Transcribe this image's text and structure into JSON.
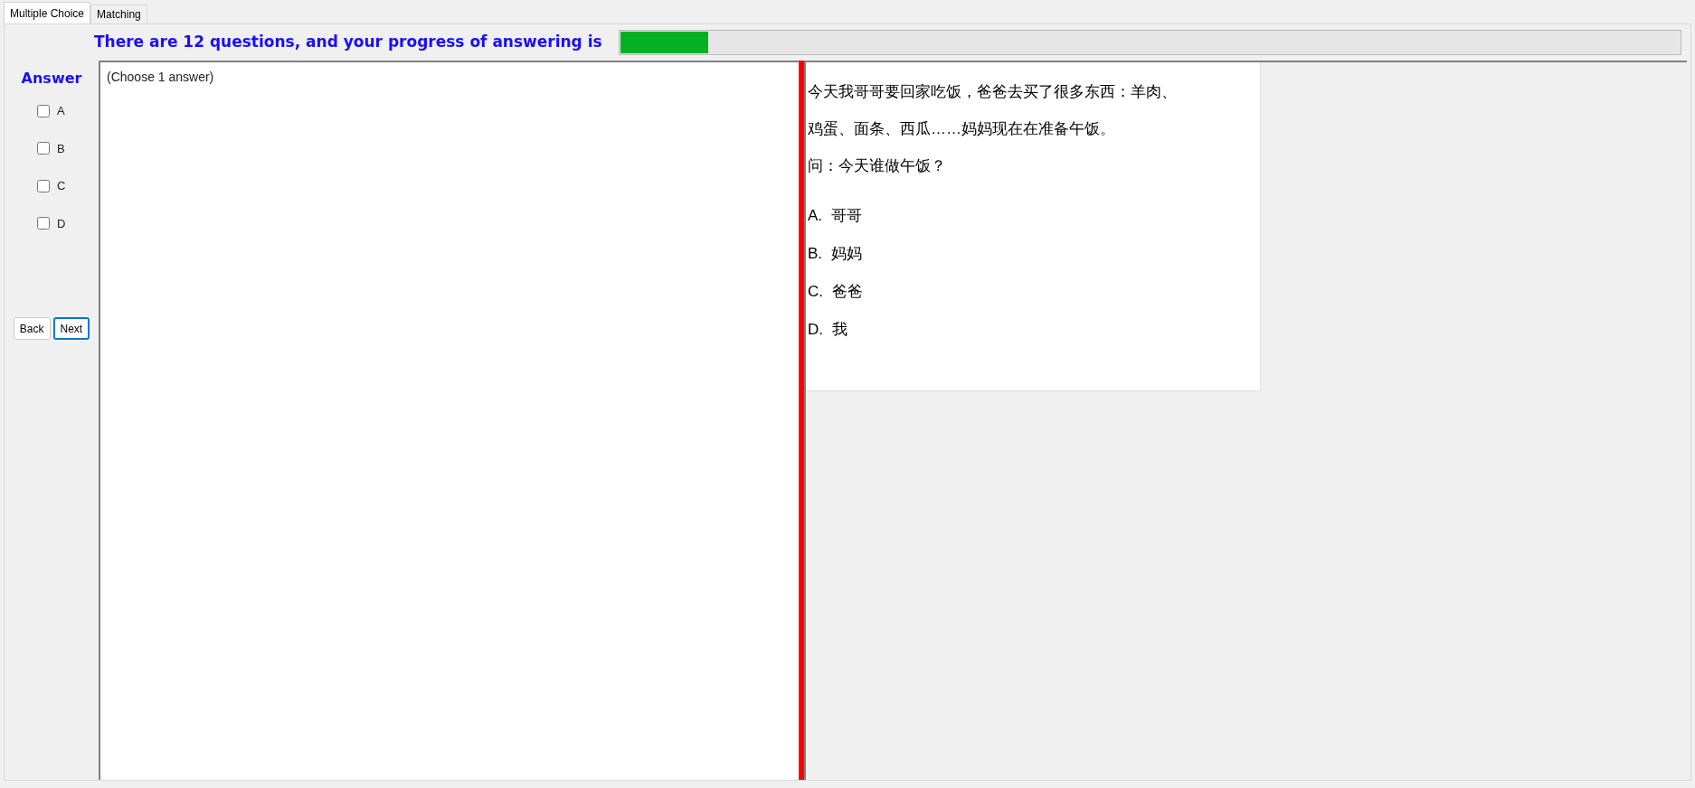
{
  "tabs": [
    {
      "label": "Multiple Choice",
      "selected": true
    },
    {
      "label": "Matching",
      "selected": false
    }
  ],
  "progress": {
    "label": "There are 12 questions, and your progress of answering is",
    "level": 0.083
  },
  "answer": {
    "title": "Answer",
    "options": [
      {
        "label": "A",
        "checked": false
      },
      {
        "label": "B",
        "checked": false
      },
      {
        "label": "C",
        "checked": false
      },
      {
        "label": "D",
        "checked": false
      }
    ]
  },
  "buttons": [
    {
      "label": "Back",
      "focused": false
    },
    {
      "label": "Next",
      "focused": true
    }
  ],
  "question_panel": {
    "hint": "(Choose 1 answer)"
  },
  "passage": {
    "lines": [
      "今天我哥哥要回家吃饭，爸爸去买了很多东西：羊肉、",
      "鸡蛋、面条、西瓜……妈妈现在在准备午饭。",
      "问：今天谁做午饭？"
    ],
    "choices": [
      {
        "letter": "A.",
        "text": "哥哥"
      },
      {
        "letter": "B.",
        "text": "妈妈"
      },
      {
        "letter": "C.",
        "text": "爸爸"
      },
      {
        "letter": "D.",
        "text": "我"
      }
    ]
  }
}
